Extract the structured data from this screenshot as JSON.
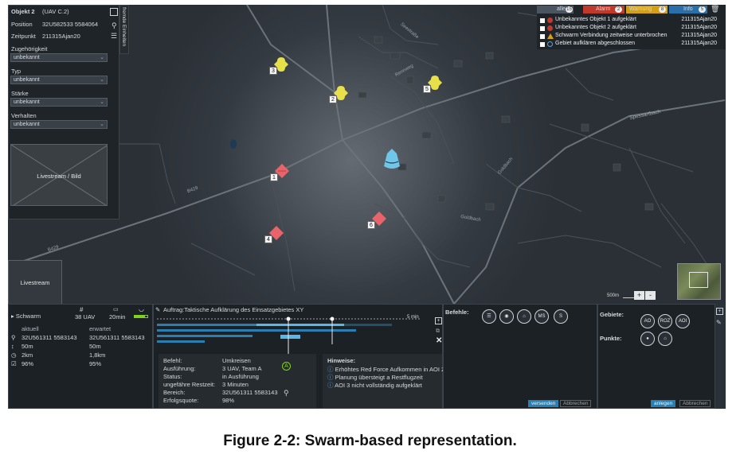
{
  "object_panel": {
    "title": "Objekt 2",
    "subtitle": "(UAV C.2)",
    "position_label": "Position",
    "position_value": "32U582533 5584064",
    "time_label": "Zeitpunkt",
    "time_value": "211315Ajan20",
    "fields": [
      {
        "label": "Zugehörigkeit",
        "value": "unbekannt"
      },
      {
        "label": "Typ",
        "value": "unbekannt"
      },
      {
        "label": "Stärke",
        "value": "unbekannt"
      },
      {
        "label": "Verhalten",
        "value": "unbekannt"
      }
    ],
    "livestream_image_label": "Livestream / Bild",
    "side_tab_label": "fremde Einheiten"
  },
  "livestream_label": "Livestream",
  "alerts": {
    "tabs": [
      {
        "label": "alle",
        "count": "15",
        "color": "#4a5560"
      },
      {
        "label": "Alarm",
        "count": "2",
        "color": "#c0392b"
      },
      {
        "label": "Warnung",
        "count": "8",
        "color": "#d4a017"
      },
      {
        "label": "Info",
        "count": "5",
        "color": "#2a6fa8"
      }
    ],
    "items": [
      {
        "text": "Unbekanntes Objekt 1 aufgeklärt",
        "time": "211315Ajan20",
        "icon": "alarm-icon",
        "color": "#c0392b"
      },
      {
        "text": "Unbekanntes Objekt 2 aufgeklärt",
        "time": "211315Ajan20",
        "icon": "alarm-icon",
        "color": "#c0392b"
      },
      {
        "text": "Schwarm Verbindung zeitweise unterbrochen",
        "time": "211315Ajan20",
        "icon": "warning-icon",
        "color": "#d4a017"
      },
      {
        "text": "Gebiet aufklären abgeschlossen",
        "time": "211315Ajan20",
        "icon": "info-icon",
        "color": "#2a6fa8"
      }
    ]
  },
  "map": {
    "roads": [
      "B429",
      "B429",
      "Goldbach",
      "Goldbach",
      "Spessartbach",
      "Rennweg",
      "Seestraße"
    ],
    "markers": [
      {
        "num": "3",
        "kind": "unknown",
        "color": "#e8e04a"
      },
      {
        "num": "2",
        "kind": "unknown",
        "color": "#e8e04a"
      },
      {
        "num": "5",
        "kind": "unknown",
        "color": "#e8e04a"
      },
      {
        "num": "1",
        "kind": "hostile",
        "color": "#e8646a"
      },
      {
        "num": "4",
        "kind": "hostile",
        "color": "#e8646a"
      },
      {
        "num": "6",
        "kind": "hostile",
        "color": "#e8646a"
      }
    ],
    "swarm_color": "#6fc6e8",
    "scale_label": "500m",
    "zoom_in": "+",
    "zoom_out": "-"
  },
  "swarm": {
    "title": "Schwarm",
    "uav_count": "38 UAV",
    "duration": "20min",
    "col_current": "aktuell",
    "col_expected": "erwartet",
    "rows": [
      {
        "icon": "location-icon",
        "current": "32U561311 5583143",
        "expected": "32U561311 5583143"
      },
      {
        "icon": "altitude-icon",
        "current": "50m",
        "expected": "50m"
      },
      {
        "icon": "range-icon",
        "current": "2km",
        "expected": "1,8km"
      },
      {
        "icon": "check-icon",
        "current": "96%",
        "expected": "95%"
      }
    ]
  },
  "order": {
    "title": "Auftrag:Taktische Aufklärung des Einsatzgebietes XY",
    "details": [
      {
        "label": "Befehl:",
        "value": "Umkreisen"
      },
      {
        "label": "Ausführung:",
        "value": "3 UAV, Team A"
      },
      {
        "label": "Status:",
        "value": "in Ausführung"
      },
      {
        "label": "ungefähre Restzeit:",
        "value": "3 Minuten"
      },
      {
        "label": "Bereich:",
        "value": "32U561311 5583143"
      },
      {
        "label": "Erfolgsquote:",
        "value": "98%"
      }
    ],
    "team_badge": "A",
    "hints_title": "Hinweise:",
    "hints": [
      "Erhöhtes Red Force Aufkommen in AOI 2",
      "Planung übersteigt a Restflugzeit",
      "AOI 3 nicht vollständig aufgeklärt"
    ],
    "timeline_end": "5 min"
  },
  "commands": {
    "title": "Befehle:",
    "buttons": [
      "MS",
      "S"
    ],
    "send": "versenden",
    "cancel": "Abbrechen"
  },
  "areas": {
    "areas_label": "Gebiete:",
    "area_buttons": [
      "AO",
      "ROZ",
      "AOI"
    ],
    "points_label": "Punkte:",
    "create": "anlegen",
    "cancel": "Abbrechen"
  },
  "caption": "Figure 2-2: Swarm-based representation."
}
